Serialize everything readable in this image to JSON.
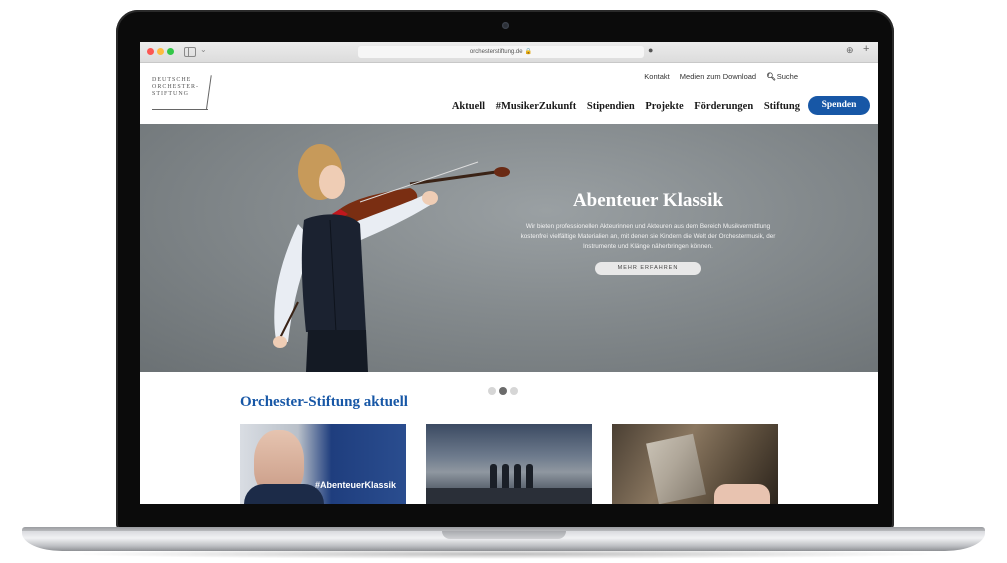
{
  "browser": {
    "url": "orchesterstiftung.de"
  },
  "site": {
    "logo_lines": [
      "DEUTSCHE",
      "ORCHESTER-",
      "STIFTUNG"
    ],
    "utility_nav": [
      "Kontakt",
      "Medien zum Download",
      "Suche"
    ],
    "main_nav": [
      "Aktuell",
      "#MusikerZukunft",
      "Stipendien",
      "Projekte",
      "Förderungen",
      "Stiftung"
    ],
    "donate_label": "Spenden"
  },
  "hero": {
    "title": "Abenteuer Klassik",
    "copy": "Wir bieten professionellen Akteurinnen und Akteuren aus dem Bereich Musikvermittlung kostenfrei vielfältige Materialien an, mit denen sie Kindern die Welt der Orchestermusik, der Instrumente und Klänge näherbringen können.",
    "button_label": "MEHR ERFAHREN",
    "carousel": {
      "count": 3,
      "active": 2
    }
  },
  "news": {
    "section_title": "Orchester-Stiftung aktuell",
    "cards": [
      {
        "caption": "#AbenteuerKlassik"
      },
      {
        "caption": ""
      },
      {
        "caption": ""
      }
    ]
  },
  "colors": {
    "brand_blue": "#1757a6",
    "hero_gray": "#848a8d"
  }
}
